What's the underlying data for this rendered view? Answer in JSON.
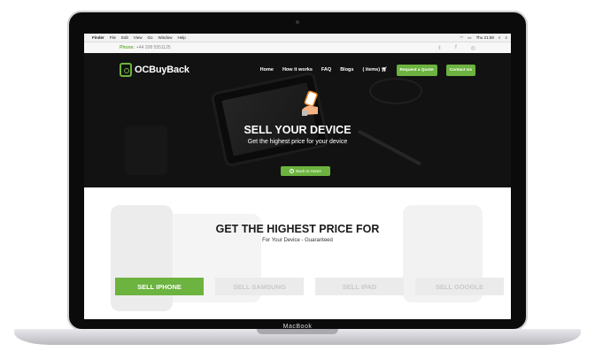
{
  "device": {
    "brand_label": "MacBook"
  },
  "menubar": {
    "items": [
      "Finder",
      "File",
      "Edit",
      "View",
      "Go",
      "Window",
      "Help"
    ],
    "clock": "Thu 21:58"
  },
  "topbar": {
    "phone_label": "Phone:",
    "phone_number": "+44 208 5551125"
  },
  "nav": {
    "logo": "OCBuyBack",
    "links": [
      "Home",
      "How it works",
      "FAQ",
      "Blogs",
      "( items)"
    ],
    "cta1": "Request a Quote",
    "cta2": "Contact Us"
  },
  "hero": {
    "title": "SELL YOUR DEVICE",
    "subtitle": "Get the highest price for your device",
    "back_button": "Back to Home"
  },
  "section": {
    "title": "GET THE HIGHEST PRICE FOR",
    "subtitle": "For Your Device - Guaranteed",
    "tabs": [
      {
        "label": "SELL IPHONE",
        "active": true
      },
      {
        "label": "SELL SAMSUNG",
        "active": false
      },
      {
        "label": "SELL IPAD",
        "active": false
      },
      {
        "label": "SELL GOOGLE",
        "active": false
      }
    ]
  },
  "colors": {
    "accent": "#6cb33f",
    "dark": "#1c1c1c"
  }
}
